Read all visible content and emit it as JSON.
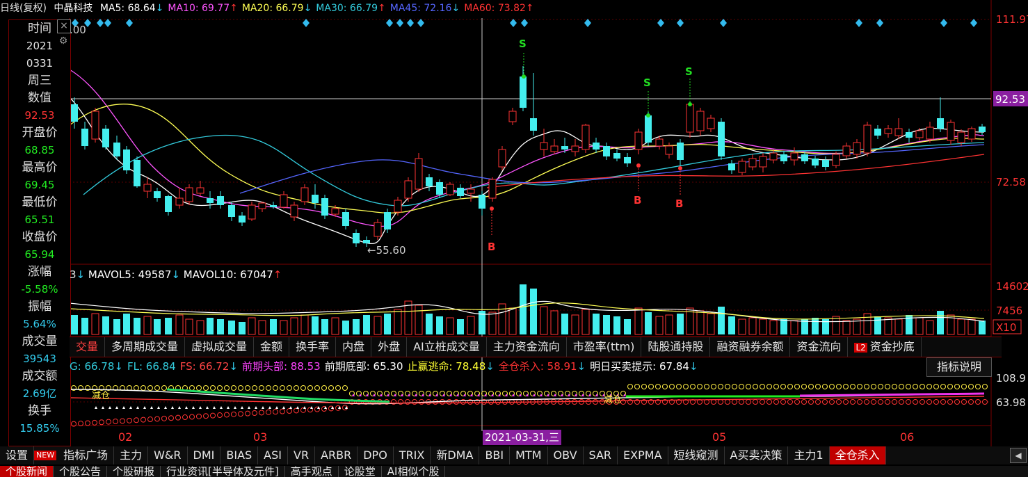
{
  "header": {
    "period": "日线(复权)",
    "stock_name": "中晶科技",
    "ma": [
      {
        "label": "MA5: 68.64",
        "arrow": "↓",
        "color": "#ffffff"
      },
      {
        "label": "MA10: 69.77",
        "arrow": "↑",
        "color": "#ff55ff"
      },
      {
        "label": "MA20: 66.79",
        "arrow": "↓",
        "color": "#ffff55"
      },
      {
        "label": "MA30: 66.79",
        "arrow": "↑",
        "color": "#33ccdd"
      },
      {
        "label": "MA45: 72.16",
        "arrow": "↓",
        "color": "#5566ff"
      },
      {
        "label": "MA60: 73.82",
        "arrow": "↑",
        "color": "#ff3333"
      }
    ]
  },
  "info_panel": {
    "time_label": "时间",
    "year": "2021",
    "date": "0331",
    "weekday": "周三",
    "value_label": "数值",
    "value": "92.53",
    "open_label": "开盘价",
    "open": "68.85",
    "high_label": "最高价",
    "high": "69.45",
    "low_label": "最低价",
    "low": "65.51",
    "close_label": "收盘价",
    "close": "65.94",
    "change_label": "涨幅",
    "change": "-5.58%",
    "amplitude_label": "振幅",
    "amplitude": "5.64%",
    "volume_label": "成交量",
    "volume": "39543",
    "amount_label": "成交额",
    "amount": "2.69亿",
    "turnover_label": "换手",
    "turnover": "15.85%",
    "partial_value": ".00"
  },
  "price_axis": {
    "top": "111.97",
    "crosshair": "92.53",
    "mid": "72.58"
  },
  "min_label": "←55.60",
  "signals": {
    "buy": "B",
    "sell": "S"
  },
  "volume_header": {
    "lead": "3",
    "mavol5": "MAVOL5: 49587",
    "mavol5_arrow": "↓",
    "mavol10": "MAVOL10: 67047",
    "mavol10_arrow": "↑"
  },
  "volume_axis": {
    "top": "14602",
    "mid": "7456",
    "unit": "X10"
  },
  "indicator_tabs": [
    "交量",
    "多周期成交量",
    "虚拟成交量",
    "金额",
    "换手率",
    "内盘",
    "外盘",
    "AI立桩成交量",
    "主力资金流向",
    "市盈率(ttm)",
    "陆股通持股",
    "融资融券余额",
    "资金流向",
    "资金抄底"
  ],
  "l2_badge": "L2",
  "indicator_line": [
    {
      "text": "G: 66.78",
      "arrow": "↓",
      "color": "#33ccdd"
    },
    {
      "text": "FL: 66.84",
      "arrow": "",
      "color": "#33ccdd"
    },
    {
      "text": "FS: 66.72",
      "arrow": "↓",
      "color": "#ff4444"
    },
    {
      "text": "前期头部: 88.53",
      "arrow": "",
      "color": "#ff44ff"
    },
    {
      "text": "前期底部: 65.30",
      "arrow": "",
      "color": "#ffffff"
    },
    {
      "text": "止赢逃命: 78.48",
      "arrow": "↓",
      "color": "#ffff33"
    },
    {
      "text": "全仓杀入: 58.91",
      "arrow": "↓",
      "color": "#ff3333"
    },
    {
      "text": "明日买卖提示: 67.84",
      "arrow": "↓",
      "color": "#ffffff"
    }
  ],
  "indicator_button": "指标说明",
  "indicator_axis": {
    "top": "108.9",
    "mid": "63.98"
  },
  "indicator_labels": {
    "reduce": "减仓"
  },
  "x_axis": {
    "m02": "02",
    "m03": "03",
    "m05": "05",
    "m06": "06",
    "cursor_date": "2021-03-31,三"
  },
  "bottom_tabs": [
    "设置",
    "指标广场",
    "主力",
    "W&R",
    "DMI",
    "BIAS",
    "ASI",
    "VR",
    "ARBR",
    "DPO",
    "TRIX",
    "新DMA",
    "BBI",
    "MTM",
    "OBV",
    "SAR",
    "EXPMA",
    "短线窥测",
    "A买卖决策",
    "主力1",
    "全仓杀入"
  ],
  "new_badge": "NEW",
  "news_tabs": [
    "个股新闻",
    "个股公告",
    "个股研报",
    "行业资讯[半导体及元件]",
    "高手观点",
    "论股堂",
    "AI相似个股"
  ],
  "colors": {
    "up": "#ff3333",
    "down": "#44eeee",
    "frame": "#7a0000"
  }
}
